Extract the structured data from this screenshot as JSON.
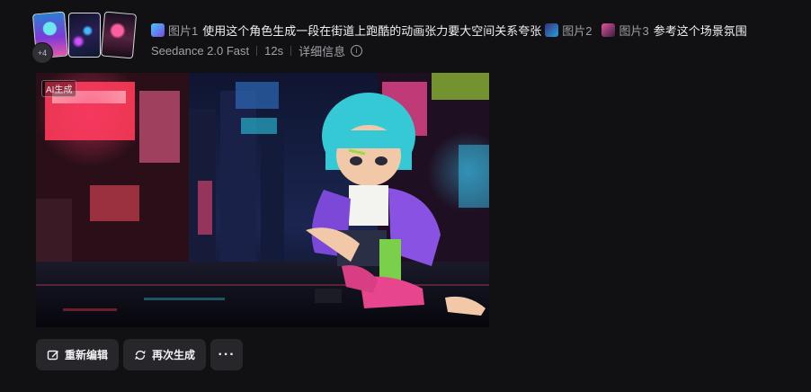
{
  "reference_count": "+4",
  "prompt": {
    "ref1_label": "图片1",
    "text1": "使用这个角色生成一段在街道上跑酷的动画张力要大空间关系夸张",
    "ref2_label": "图片2",
    "ref3_label": "图片3",
    "text2": "参考这个场景氛围"
  },
  "meta": {
    "model": "Seedance 2.0 Fast",
    "duration": "12s",
    "details_label": "详细信息"
  },
  "media": {
    "ai_badge": "AI生成"
  },
  "actions": {
    "re_edit": "重新编辑",
    "regenerate": "再次生成",
    "more": "···"
  }
}
